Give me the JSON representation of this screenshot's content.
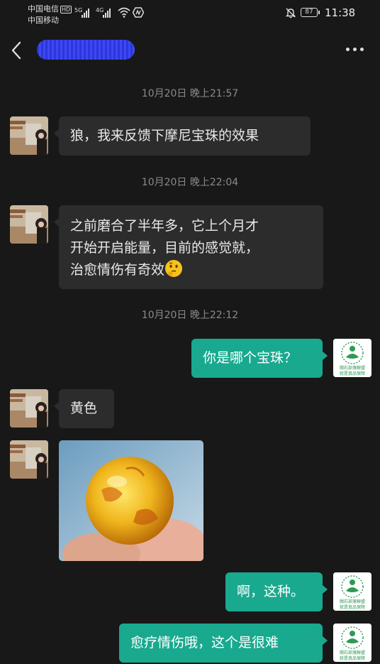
{
  "status_bar": {
    "carrier_1": "中国电信",
    "carrier_1_badge": "HD",
    "carrier_2": "中国移动",
    "network_1": "5G",
    "network_2": "4G",
    "battery": "87",
    "time": "11:38"
  },
  "header": {
    "title": "",
    "back_icon": "chevron-left-icon",
    "more_icon": "more-dots-icon"
  },
  "timestamps": [
    "10月20日 晚上21:57",
    "10月20日 晚上22:04",
    "10月20日 晚上22:12"
  ],
  "messages": [
    {
      "side": "in",
      "text": "狼，我来反馈下摩尼宝珠的效果"
    },
    {
      "side": "in",
      "text_lines": [
        "之前磨合了半年多，它上个月才",
        "开始开启能量，目前的感觉就，",
        "治愈情伤有奇效"
      ],
      "emoji": "thinking-face"
    },
    {
      "side": "out",
      "text": "你是哪个宝珠？"
    },
    {
      "side": "in",
      "text": "黄色"
    },
    {
      "side": "in",
      "image": "amber-bead-photo"
    },
    {
      "side": "out",
      "text": "啊，这种。"
    },
    {
      "side": "out",
      "text": "愈疗情伤哦，这个是很难"
    }
  ],
  "my_avatar_text": "隕石部落聯盟 就是真品保障",
  "colors": {
    "background": "#181818",
    "incoming_bubble": "#2c2c2c",
    "outgoing_bubble": "#19a98f",
    "timestamp": "#8a8a8a"
  }
}
